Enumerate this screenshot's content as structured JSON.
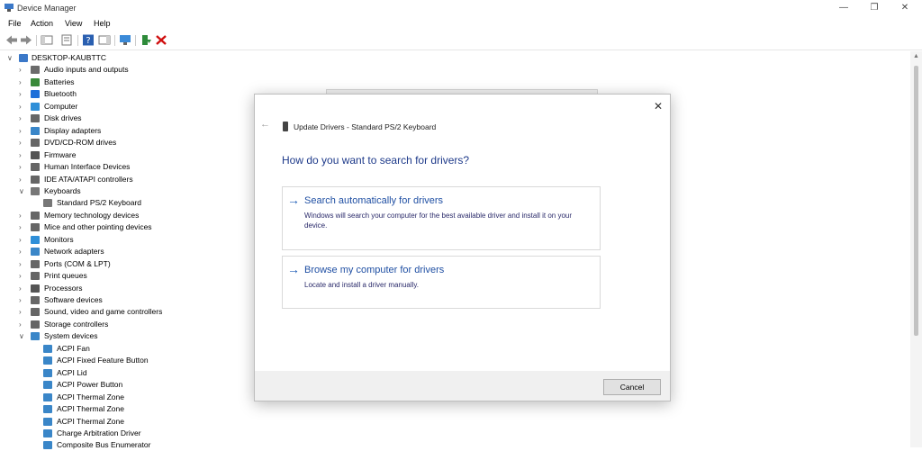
{
  "window": {
    "title": "Device Manager",
    "icons": {
      "app": "device-manager-icon",
      "minimize": "minimize-icon",
      "maximize": "restore-icon",
      "close": "close-icon"
    }
  },
  "menu": {
    "file": "File",
    "action": "Action",
    "view": "View",
    "help": "Help"
  },
  "toolbar": {
    "items": [
      "back-arrow-icon",
      "forward-arrow-icon",
      "show-hide-tree-icon",
      "properties-icon",
      "help-icon",
      "action-pane-icon",
      "monitor-icon",
      "update-driver-icon",
      "uninstall-icon"
    ]
  },
  "tree": {
    "root": "DESKTOP-KAUBTTC",
    "items": [
      {
        "label": "Audio inputs and outputs",
        "icon": "speaker-icon",
        "color": "#6b6b6b",
        "expanded": false
      },
      {
        "label": "Batteries",
        "icon": "battery-icon",
        "color": "#3a8a3a",
        "expanded": false
      },
      {
        "label": "Bluetooth",
        "icon": "bluetooth-icon",
        "color": "#1e6fd9",
        "expanded": false
      },
      {
        "label": "Computer",
        "icon": "computer-icon",
        "color": "#2f8fd8",
        "expanded": false
      },
      {
        "label": "Disk drives",
        "icon": "disk-drive-icon",
        "color": "#666666",
        "expanded": false
      },
      {
        "label": "Display adapters",
        "icon": "display-adapter-icon",
        "color": "#3a86c8",
        "expanded": false
      },
      {
        "label": "DVD/CD-ROM drives",
        "icon": "dvd-drive-icon",
        "color": "#666666",
        "expanded": false
      },
      {
        "label": "Firmware",
        "icon": "firmware-icon",
        "color": "#555555",
        "expanded": false
      },
      {
        "label": "Human Interface Devices",
        "icon": "hid-icon",
        "color": "#666666",
        "expanded": false
      },
      {
        "label": "IDE ATA/ATAPI controllers",
        "icon": "ide-controller-icon",
        "color": "#666666",
        "expanded": false
      },
      {
        "label": "Keyboards",
        "icon": "keyboard-icon",
        "color": "#777777",
        "expanded": true
      },
      {
        "label": "Standard PS/2 Keyboard",
        "icon": "keyboard-icon",
        "color": "#777777",
        "child": true
      },
      {
        "label": "Memory technology devices",
        "icon": "memory-icon",
        "color": "#666666",
        "expanded": false
      },
      {
        "label": "Mice and other pointing devices",
        "icon": "mouse-icon",
        "color": "#666666",
        "expanded": false
      },
      {
        "label": "Monitors",
        "icon": "monitor-icon",
        "color": "#2f8fd8",
        "expanded": false
      },
      {
        "label": "Network adapters",
        "icon": "network-adapter-icon",
        "color": "#3a86c8",
        "expanded": false
      },
      {
        "label": "Ports (COM & LPT)",
        "icon": "port-icon",
        "color": "#666666",
        "expanded": false
      },
      {
        "label": "Print queues",
        "icon": "printer-icon",
        "color": "#666666",
        "expanded": false
      },
      {
        "label": "Processors",
        "icon": "processor-icon",
        "color": "#555555",
        "expanded": false
      },
      {
        "label": "Software devices",
        "icon": "software-device-icon",
        "color": "#666666",
        "expanded": false
      },
      {
        "label": "Sound, video and game controllers",
        "icon": "sound-controller-icon",
        "color": "#666666",
        "expanded": false
      },
      {
        "label": "Storage controllers",
        "icon": "storage-controller-icon",
        "color": "#666666",
        "expanded": false
      },
      {
        "label": "System devices",
        "icon": "system-device-icon",
        "color": "#3a86c8",
        "expanded": true
      },
      {
        "label": "ACPI Fan",
        "icon": "system-device-icon",
        "color": "#3a86c8",
        "child": true
      },
      {
        "label": "ACPI Fixed Feature Button",
        "icon": "system-device-icon",
        "color": "#3a86c8",
        "child": true
      },
      {
        "label": "ACPI Lid",
        "icon": "system-device-icon",
        "color": "#3a86c8",
        "child": true
      },
      {
        "label": "ACPI Power Button",
        "icon": "system-device-icon",
        "color": "#3a86c8",
        "child": true
      },
      {
        "label": "ACPI Thermal Zone",
        "icon": "system-device-icon",
        "color": "#3a86c8",
        "child": true
      },
      {
        "label": "ACPI Thermal Zone",
        "icon": "system-device-icon",
        "color": "#3a86c8",
        "child": true
      },
      {
        "label": "ACPI Thermal Zone",
        "icon": "system-device-icon",
        "color": "#3a86c8",
        "child": true
      },
      {
        "label": "Charge Arbitration Driver",
        "icon": "system-device-icon",
        "color": "#3a86c8",
        "child": true
      },
      {
        "label": "Composite Bus Enumerator",
        "icon": "system-device-icon",
        "color": "#3a86c8",
        "child": true
      }
    ]
  },
  "dialog": {
    "title": "Update Drivers - Standard PS/2 Keyboard",
    "heading": "How do you want to search for drivers?",
    "options": [
      {
        "title": "Search automatically for drivers",
        "desc": "Windows will search your computer for the best available driver and install it on your device."
      },
      {
        "title": "Browse my computer for drivers",
        "desc": "Locate and install a driver manually."
      }
    ],
    "cancel_label": "Cancel",
    "accent_color": "#1f5eb8"
  }
}
